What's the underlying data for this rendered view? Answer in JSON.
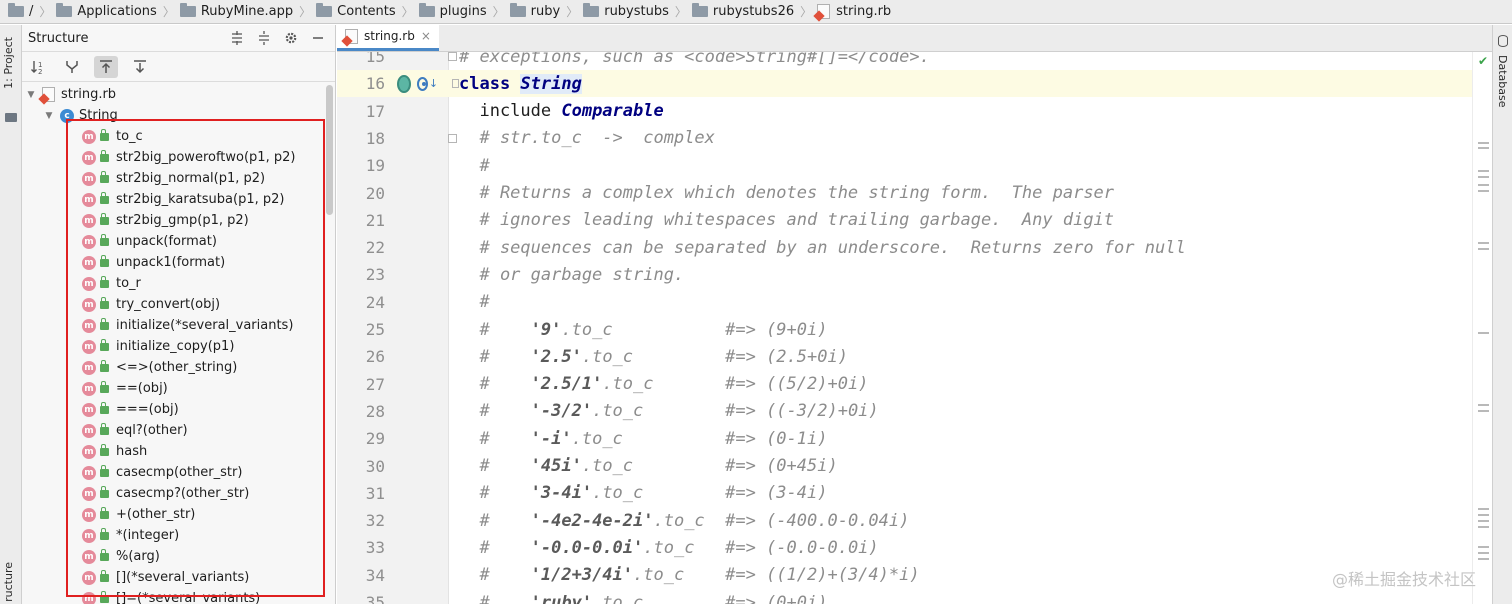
{
  "breadcrumb": [
    {
      "label": "/",
      "icon": "folder-icon"
    },
    {
      "label": "Applications",
      "icon": "folder-icon"
    },
    {
      "label": "RubyMine.app",
      "icon": "folder-icon"
    },
    {
      "label": "Contents",
      "icon": "folder-icon"
    },
    {
      "label": "plugins",
      "icon": "folder-icon"
    },
    {
      "label": "ruby",
      "icon": "folder-icon"
    },
    {
      "label": "rubystubs",
      "icon": "folder-icon"
    },
    {
      "label": "rubystubs26",
      "icon": "folder-icon"
    },
    {
      "label": "string.rb",
      "icon": "ruby-file-icon"
    }
  ],
  "left_strip": {
    "project_tab": "1: Project",
    "structure_tab": "ructure"
  },
  "structure": {
    "title": "Structure",
    "file_node": "string.rb",
    "class_node": "String",
    "class_icon_letter": "c",
    "method_icon_letter": "m",
    "methods": [
      "to_c",
      "str2big_poweroftwo(p1, p2)",
      "str2big_normal(p1, p2)",
      "str2big_karatsuba(p1, p2)",
      "str2big_gmp(p1, p2)",
      "unpack(format)",
      "unpack1(format)",
      "to_r",
      "try_convert(obj)",
      "initialize(*several_variants)",
      "initialize_copy(p1)",
      "<=>(other_string)",
      "==(obj)",
      "===(obj)",
      "eql?(other)",
      "hash",
      "casecmp(other_str)",
      "casecmp?(other_str)",
      "+(other_str)",
      "*(integer)",
      "%(arg)",
      "[](*several_variants)",
      "[]=(*several_variants)"
    ]
  },
  "editor": {
    "tab_label": "string.rb",
    "close_glyph": "×",
    "current_line": 16,
    "lines": [
      {
        "num": "15",
        "segments": [
          {
            "t": "# exceptions, such as <code>String#[]=</code>.",
            "c": "cmt"
          }
        ]
      },
      {
        "num": "16",
        "segments": [
          {
            "t": "class ",
            "c": "kw"
          },
          {
            "t": "String",
            "c": "cls-hl"
          }
        ]
      },
      {
        "num": "17",
        "segments": [
          {
            "t": "  include ",
            "c": "code"
          },
          {
            "t": "Comparable",
            "c": "cls"
          }
        ]
      },
      {
        "num": "18",
        "segments": [
          {
            "t": "  # str.to_c  ->  complex",
            "c": "cmt"
          }
        ]
      },
      {
        "num": "19",
        "segments": [
          {
            "t": "  #",
            "c": "cmt"
          }
        ]
      },
      {
        "num": "20",
        "segments": [
          {
            "t": "  # Returns a complex which denotes the string form.  The parser",
            "c": "cmt"
          }
        ]
      },
      {
        "num": "21",
        "segments": [
          {
            "t": "  # ignores leading whitespaces and trailing garbage.  Any digit",
            "c": "cmt"
          }
        ]
      },
      {
        "num": "22",
        "segments": [
          {
            "t": "  # sequences can be separated by an underscore.  Returns zero for null",
            "c": "cmt"
          }
        ]
      },
      {
        "num": "23",
        "segments": [
          {
            "t": "  # or garbage string.",
            "c": "cmt"
          }
        ]
      },
      {
        "num": "24",
        "segments": [
          {
            "t": "  #",
            "c": "cmt"
          }
        ]
      },
      {
        "num": "25",
        "segments": [
          {
            "t": "  #    ",
            "c": "cmt"
          },
          {
            "t": "'9'",
            "c": "str"
          },
          {
            "t": ".to_c           #=> (9+0i)",
            "c": "cmt"
          }
        ]
      },
      {
        "num": "26",
        "segments": [
          {
            "t": "  #    ",
            "c": "cmt"
          },
          {
            "t": "'2.5'",
            "c": "str"
          },
          {
            "t": ".to_c         #=> (2.5+0i)",
            "c": "cmt"
          }
        ]
      },
      {
        "num": "27",
        "segments": [
          {
            "t": "  #    ",
            "c": "cmt"
          },
          {
            "t": "'2.5/1'",
            "c": "str"
          },
          {
            "t": ".to_c       #=> ((5/2)+0i)",
            "c": "cmt"
          }
        ]
      },
      {
        "num": "28",
        "segments": [
          {
            "t": "  #    ",
            "c": "cmt"
          },
          {
            "t": "'-3/2'",
            "c": "str"
          },
          {
            "t": ".to_c        #=> ((-3/2)+0i)",
            "c": "cmt"
          }
        ]
      },
      {
        "num": "29",
        "segments": [
          {
            "t": "  #    ",
            "c": "cmt"
          },
          {
            "t": "'-i'",
            "c": "str"
          },
          {
            "t": ".to_c          #=> (0-1i)",
            "c": "cmt"
          }
        ]
      },
      {
        "num": "30",
        "segments": [
          {
            "t": "  #    ",
            "c": "cmt"
          },
          {
            "t": "'45i'",
            "c": "str"
          },
          {
            "t": ".to_c         #=> (0+45i)",
            "c": "cmt"
          }
        ]
      },
      {
        "num": "31",
        "segments": [
          {
            "t": "  #    ",
            "c": "cmt"
          },
          {
            "t": "'3-4i'",
            "c": "str"
          },
          {
            "t": ".to_c        #=> (3-4i)",
            "c": "cmt"
          }
        ]
      },
      {
        "num": "32",
        "segments": [
          {
            "t": "  #    ",
            "c": "cmt"
          },
          {
            "t": "'-4e2-4e-2i'",
            "c": "str"
          },
          {
            "t": ".to_c  #=> (-400.0-0.04i)",
            "c": "cmt"
          }
        ]
      },
      {
        "num": "33",
        "segments": [
          {
            "t": "  #    ",
            "c": "cmt"
          },
          {
            "t": "'-0.0-0.0i'",
            "c": "str"
          },
          {
            "t": ".to_c   #=> (-0.0-0.0i)",
            "c": "cmt"
          }
        ]
      },
      {
        "num": "34",
        "segments": [
          {
            "t": "  #    ",
            "c": "cmt"
          },
          {
            "t": "'1/2+3/4i'",
            "c": "str"
          },
          {
            "t": ".to_c    #=> ((1/2)+(3/4)*i)",
            "c": "cmt"
          }
        ]
      },
      {
        "num": "35",
        "segments": [
          {
            "t": "  #    ",
            "c": "cmt"
          },
          {
            "t": "'ruby'",
            "c": "str"
          },
          {
            "t": ".to_c        #=> (0+0i)",
            "c": "cmt"
          }
        ]
      }
    ]
  },
  "right_strip": {
    "database_tab": "Database"
  },
  "watermark": "@稀土掘金技术社区",
  "colors": {
    "highlight_box": "#e02020",
    "accent": "#4a88c7",
    "comment": "#8c8c8c",
    "keyword": "#000080"
  }
}
